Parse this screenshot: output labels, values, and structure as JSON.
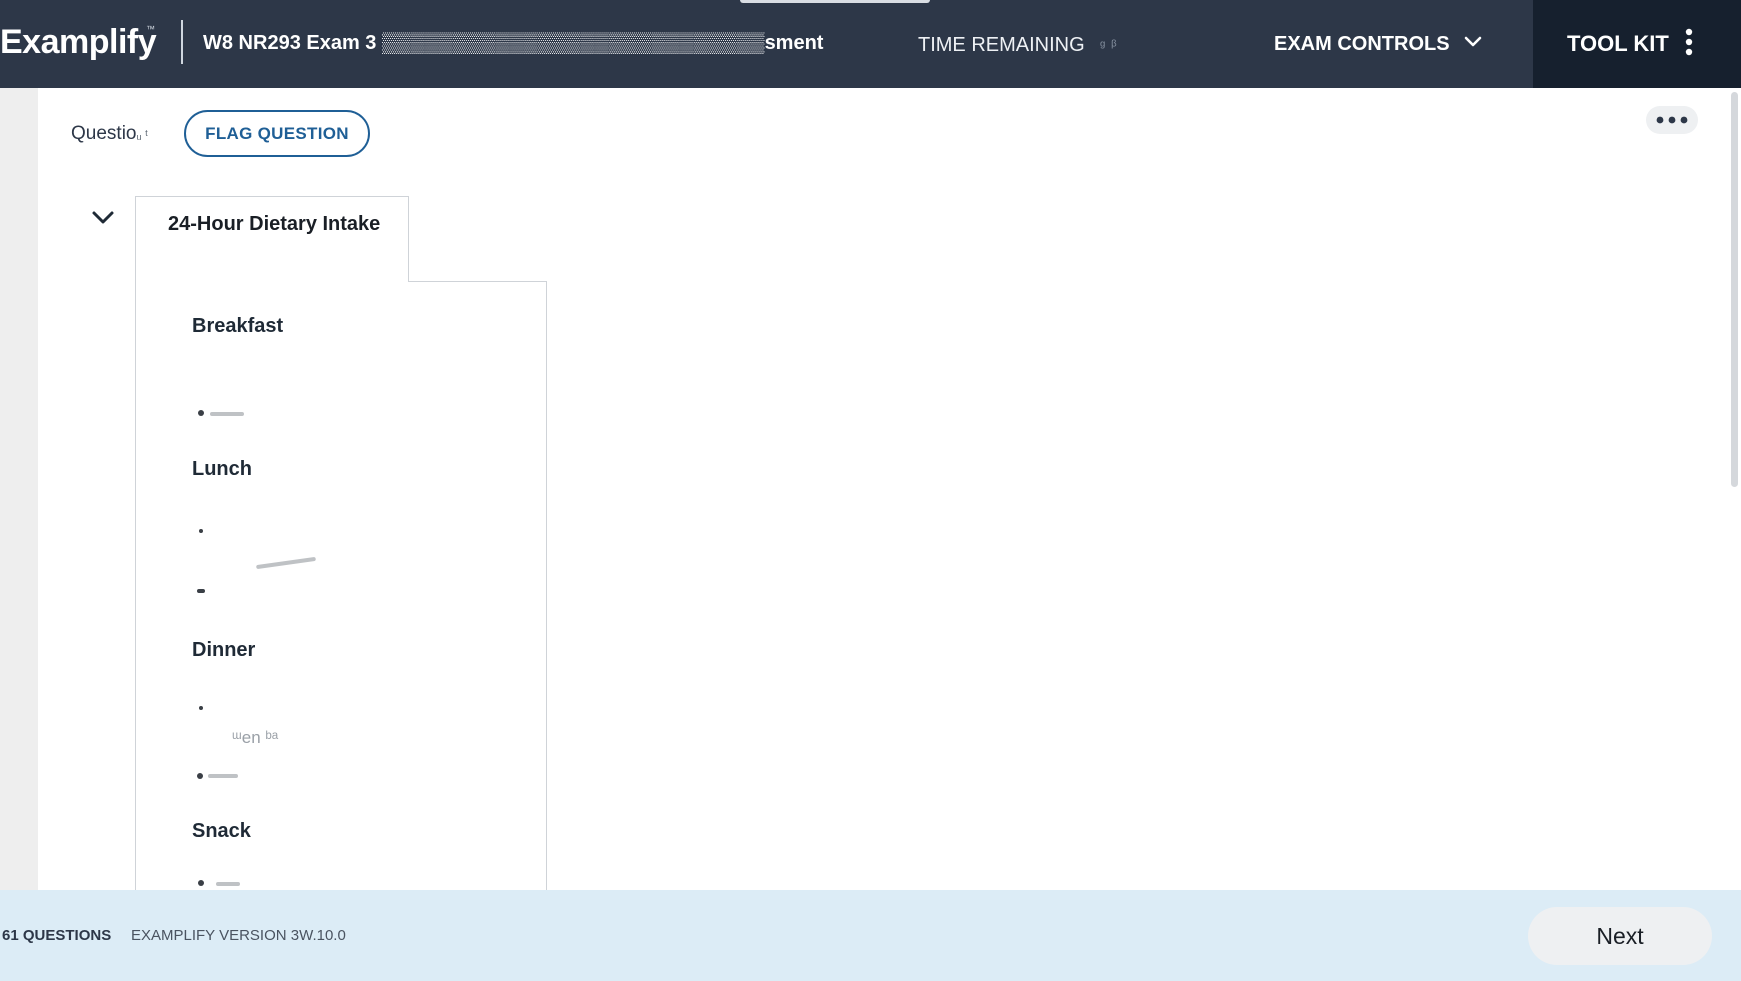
{
  "header": {
    "logo": "Examplify",
    "logo_mark": "™",
    "exam_title": "W8 NR293 Exam 3 ▒▒▒▒▒▒▒▒▒▒▒▒▒▒▒▒▒▒▒▒▒▒▒▒▒▒▒sment",
    "time_remaining_label": "TIME REMAINING",
    "time_remaining_value": "ᵍ ᵝ",
    "exam_controls_label": "EXAM CONTROLS",
    "exam_controls_icon": "chevron-down-icon",
    "toolkit_label": "TOOL KIT",
    "toolkit_icon": "vertical-ellipsis-icon",
    "colors": {
      "bar": "#2d3748",
      "toolkit_bg": "#16202e",
      "accent": "#1f5f96"
    }
  },
  "question": {
    "label": "Questio",
    "label_obscured": "ᵤ ᵗ",
    "flag_label": "FLAG QUESTION",
    "more_icon": "horizontal-ellipsis-icon"
  },
  "exhibit": {
    "tab_title": "24-Hour Dietary Intake",
    "collapse_icon": "chevron-down-icon",
    "sections": [
      {
        "heading": "Breakfast"
      },
      {
        "heading": "Lunch"
      },
      {
        "heading": "Dinner",
        "blurred_text": "ᵚen ᵇᵃ"
      },
      {
        "heading": "Snack"
      }
    ]
  },
  "footer": {
    "question_count": "61 QUESTIONS",
    "version": "EXAMPLIFY VERSION 3W.10.0",
    "next_label": "Next",
    "bg_color": "#dcecf6"
  }
}
